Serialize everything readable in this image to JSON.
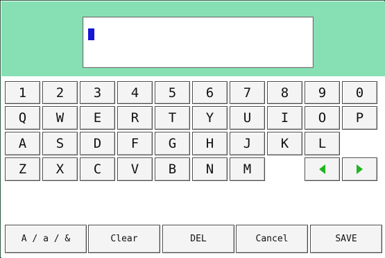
{
  "colors": {
    "top_band": "#86e0b3",
    "cursor": "#1515d6",
    "arrow": "#1fb51f"
  },
  "input": {
    "value": ""
  },
  "keyboard": {
    "row1": [
      "1",
      "2",
      "3",
      "4",
      "5",
      "6",
      "7",
      "8",
      "9",
      "0"
    ],
    "row2": [
      "Q",
      "W",
      "E",
      "R",
      "T",
      "Y",
      "U",
      "I",
      "O",
      "P"
    ],
    "row3": [
      "A",
      "S",
      "D",
      "F",
      "G",
      "H",
      "J",
      "K",
      "L"
    ],
    "row4": [
      "Z",
      "X",
      "C",
      "V",
      "B",
      "N",
      "M"
    ],
    "arrows": {
      "left": "left-arrow-icon",
      "right": "right-arrow-icon"
    }
  },
  "actions": {
    "mode": "A / a / &",
    "clear": "Clear",
    "del": "DEL",
    "cancel": "Cancel",
    "save": "SAVE"
  }
}
